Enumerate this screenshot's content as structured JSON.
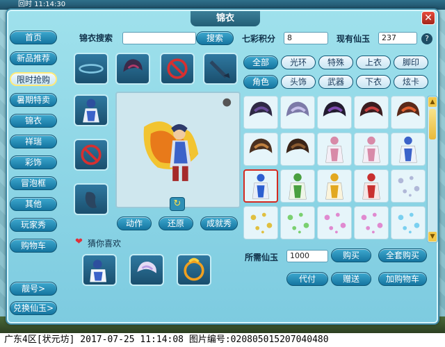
{
  "system": {
    "time": "11:14:30",
    "prefix": "回时"
  },
  "window": {
    "title": "锦衣",
    "close": "✕"
  },
  "sidebar": {
    "items": [
      "首页",
      "新品推荐",
      "限时抢购",
      "暑期特卖",
      "锦衣",
      "祥瑞",
      "彩饰",
      "冒泡框",
      "其他",
      "玩家秀",
      "购物车"
    ],
    "bottom": [
      "靓号>",
      "兑换仙玉>"
    ]
  },
  "search": {
    "label": "锦衣搜索",
    "value": "",
    "button": "搜索"
  },
  "points": {
    "label": "七彩积分",
    "value": "8"
  },
  "jade": {
    "label": "现有仙玉",
    "value": "237"
  },
  "help_icon": "?",
  "category_row1": [
    "全部",
    "光环",
    "特殊",
    "上衣",
    "脚印"
  ],
  "category_row2": [
    "角色",
    "头饰",
    "武器",
    "下衣",
    "炫卡"
  ],
  "preview_actions": [
    "动作",
    "还原",
    "成就秀"
  ],
  "recommend": {
    "label": "猜你喜欢"
  },
  "price": {
    "label": "所需仙玉",
    "value": "1000"
  },
  "buttons": {
    "buy": "购买",
    "buy_all": "全套购买",
    "pay_for": "代付",
    "gift": "赠送",
    "add_cart": "加购物车"
  },
  "footer": "广东4区[状元坊] 2017-07-25 11:14:08 图片编号:020805015207040480",
  "colors": {
    "accent": "#1575a0",
    "selected_border": "#d42a20",
    "panel": "#9fe1ec"
  },
  "grid": {
    "rows": [
      [
        "hair-dark-purple",
        "hair-lilac",
        "hair-purple-black",
        "hair-red-dark",
        "hair-red-orange"
      ],
      [
        "hair-brown",
        "hair-dark-brown",
        "costume-white-pink",
        "costume-white-pink",
        "costume-blue-white"
      ],
      [
        "costume-blue",
        "costume-green",
        "costume-yellow",
        "costume-red",
        "effect-sparkle"
      ],
      [
        "effect-sparkle-color",
        "effect-sparkle-green",
        "effect-sparkle-pink",
        "effect-sparkle-pink",
        "effect-crystal"
      ]
    ],
    "selected": [
      2,
      0
    ]
  }
}
